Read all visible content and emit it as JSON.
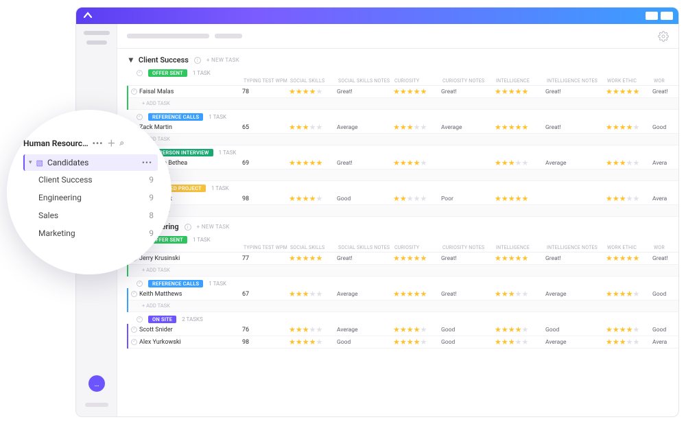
{
  "sidebar": {
    "space_title": "Human Resourc…",
    "selected_folder": "Candidates",
    "items": [
      {
        "label": "Client Success",
        "count": "9"
      },
      {
        "label": "Engineering",
        "count": "9"
      },
      {
        "label": "Sales",
        "count": "8"
      },
      {
        "label": "Marketing",
        "count": "9"
      }
    ]
  },
  "content": {
    "add_task_label": "+ ADD TASK",
    "new_task_label": "+ NEW TASK",
    "columns": {
      "typing": "TYPING TEST WPM",
      "social": "SOCIAL SKILLS",
      "social_notes": "SOCIAL SKILLS NOTES",
      "curiosity": "CURIOSITY",
      "curiosity_notes": "CURIOSITY NOTES",
      "intel": "INTELLIGENCE",
      "intel_notes": "INTELLIGENCE NOTES",
      "work": "WORK ETHIC",
      "work_notes": "WOR"
    },
    "groups": [
      {
        "title": "Client Success",
        "blocks": [
          {
            "status": {
              "label": "OFFER SENT",
              "color": "#2ec65f"
            },
            "task_count": "1 TASK",
            "show_headers": true,
            "rows": [
              {
                "name": "Faisal Malas",
                "typing": "78",
                "social": 4,
                "social_n": "Great!",
                "curiosity": 5,
                "curiosity_n": "Great!",
                "intel": 5,
                "intel_n": "Great!",
                "work": 5,
                "work_n": "Great!"
              }
            ],
            "show_add": true
          },
          {
            "status": {
              "label": "REFERENCE CALLS",
              "color": "#3aa0ff"
            },
            "task_count": "1 TASK",
            "show_headers": false,
            "rows": [
              {
                "name": "Zack Martin",
                "typing": "65",
                "social": 3,
                "social_n": "Average",
                "curiosity": 3,
                "curiosity_n": "Average",
                "intel": 5,
                "intel_n": "Great!",
                "work": 4,
                "work_n": "Good"
              }
            ],
            "show_add": true
          },
          {
            "status": {
              "label": "IN PERSON INTERVIEW",
              "color": "#1aa872"
            },
            "task_count": "1 TASK",
            "show_headers": false,
            "rows": [
              {
                "name": "Alexandra Bethea",
                "typing": "69",
                "social": 5,
                "social_n": "Great!",
                "curiosity": 4,
                "curiosity_n": "",
                "intel": 3,
                "intel_n": "Average",
                "work": 3,
                "work_n": "Avera"
              }
            ],
            "show_add": true
          },
          {
            "status": {
              "label": "RECEIVED PROJECT",
              "color": "#f5c13c"
            },
            "task_count": "1 TASK",
            "show_headers": false,
            "rows": [
              {
                "name": "Brandi West",
                "typing": "98",
                "social": 4,
                "social_n": "Good",
                "curiosity": 2,
                "curiosity_n": "Poor",
                "intel": 5,
                "intel_n": "",
                "work": 3,
                "work_n": "Avera"
              }
            ],
            "show_add": true
          }
        ]
      },
      {
        "title": "Engineering",
        "blocks": [
          {
            "status": {
              "label": "OFFER SENT",
              "color": "#2ec65f"
            },
            "task_count": "1 TASK",
            "show_headers": true,
            "rows": [
              {
                "name": "Jerry Krusinski",
                "typing": "77",
                "social": 5,
                "social_n": "Great!",
                "curiosity": 5,
                "curiosity_n": "Great!",
                "intel": 5,
                "intel_n": "Great!",
                "work": 5,
                "work_n": "Great!"
              }
            ],
            "show_add": true
          },
          {
            "status": {
              "label": "REFERENCE CALLS",
              "color": "#3aa0ff"
            },
            "task_count": "1 TASK",
            "show_headers": false,
            "rows": [
              {
                "name": "Keith Matthews",
                "typing": "67",
                "social": 3,
                "social_n": "Average",
                "curiosity": 5,
                "curiosity_n": "Great!",
                "intel": 3,
                "intel_n": "Average",
                "work": 4,
                "work_n": "Good"
              }
            ],
            "show_add": true
          },
          {
            "status": {
              "label": "ON SITE",
              "color": "#6c55ff"
            },
            "task_count": "2 TASKS",
            "show_headers": false,
            "rows": [
              {
                "name": "Scott Snider",
                "typing": "76",
                "social": 3,
                "social_n": "Average",
                "curiosity": 4,
                "curiosity_n": "Good",
                "intel": 4,
                "intel_n": "Good",
                "work": 4,
                "work_n": "Good"
              },
              {
                "name": "Alex Yurkowski",
                "typing": "98",
                "social": 4,
                "social_n": "Good",
                "curiosity": 4,
                "curiosity_n": "Good",
                "intel": 3,
                "intel_n": "Average",
                "work": 3,
                "work_n": "Avera"
              }
            ],
            "show_add": false
          }
        ]
      }
    ]
  }
}
